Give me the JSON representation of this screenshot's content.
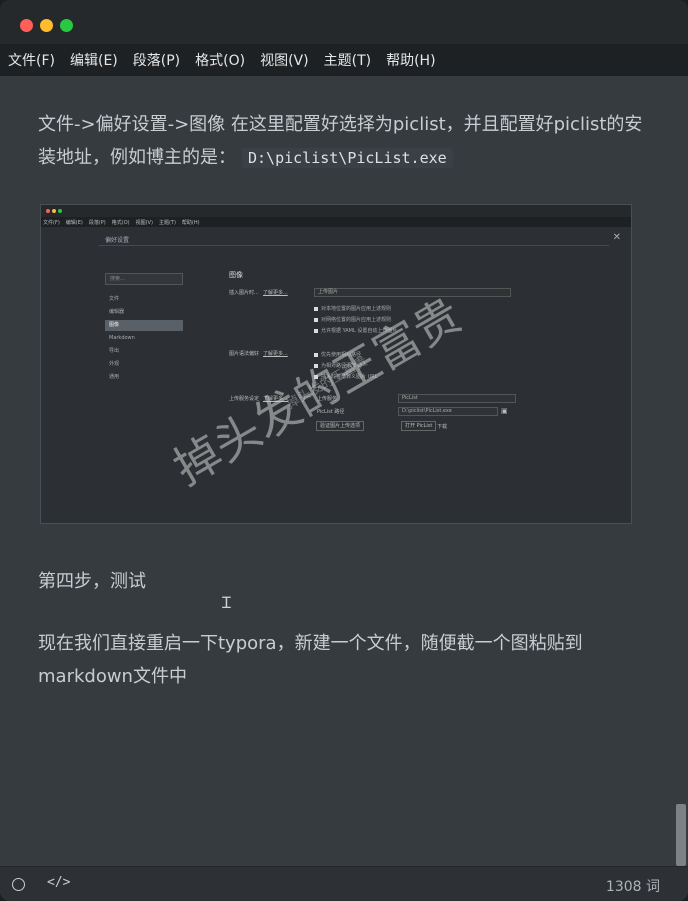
{
  "menubar": {
    "items": [
      "文件(F)",
      "编辑(E)",
      "段落(P)",
      "格式(O)",
      "视图(V)",
      "主题(T)",
      "帮助(H)"
    ]
  },
  "content": {
    "paragraph1_text": "文件->偏好设置->图像   在这里配置好选择为piclist，并且配置好piclist的安装地址，例如博主的是：",
    "paragraph1_code": "D:\\piclist\\PicList.exe",
    "paragraph2": "第四步，测试",
    "paragraph3": "现在我们直接重启一下typora，新建一个文件，随便截一个图粘贴到markdown文件中"
  },
  "screenshot": {
    "menu": [
      "文件(F)",
      "编辑(E)",
      "段落(P)",
      "格式(O)",
      "视图(V)",
      "主题(T)",
      "帮助(H)"
    ],
    "dialog_title": "偏好设置",
    "search_placeholder": "搜索...",
    "nav": [
      "文件",
      "编辑器",
      "图像",
      "Markdown",
      "导出",
      "外观",
      "通用"
    ],
    "section_title": "图像",
    "insert_label": "插入图片时...",
    "insert_link": "了解更多...",
    "insert_value": "上传图片",
    "check1": "对本地位置的图片应用上述规则",
    "check2": "对网络位置的图片应用上述规则",
    "check3": "允许根据 YAML 设置自动上传图片",
    "syntax_label": "图片语法偏好",
    "syntax_link": "了解更多...",
    "syntax_check1": "优先使用相对路径",
    "syntax_check2": "为相对路径添加 ./",
    "syntax_check3": "插入时自动转义图片 URL",
    "upload_label": "上传服务设定",
    "upload_link": "了解更多...",
    "upload_service_label": "上传服务",
    "upload_service_value": "PicList",
    "piclist_path_label": "PicList 路径",
    "piclist_path_value": "D:\\piclist\\PicList.exe",
    "btn_verify": "验证图片上传选项",
    "btn_open": "打开 PicList",
    "btn_download": "下载"
  },
  "watermark": {
    "large": "掉头发的王富贵",
    "small": "掉头发的王富贵"
  },
  "footer": {
    "code_symbol": "</>",
    "word_count": "1308 词"
  },
  "colors": {
    "background": "#363b40",
    "titlebar": "#26292c",
    "menubar": "#1e2124",
    "text": "#c9cdd1"
  }
}
